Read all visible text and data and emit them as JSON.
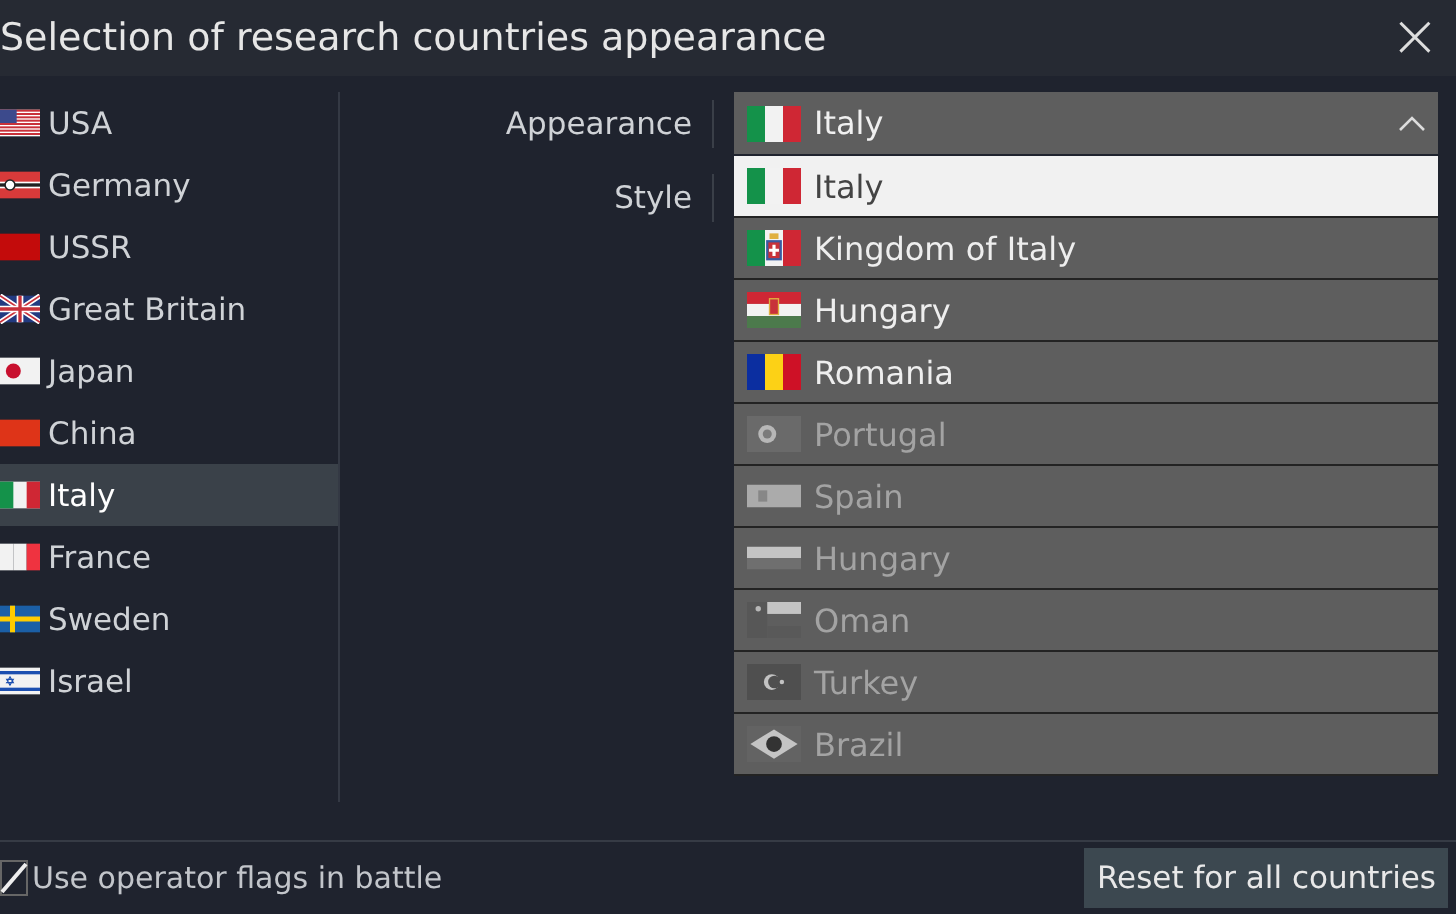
{
  "window": {
    "title": "Selection of research countries appearance",
    "close": "×"
  },
  "countries": [
    {
      "name": "USA",
      "kind": "usa",
      "selected": false
    },
    {
      "name": "Germany",
      "kind": "germany",
      "selected": false
    },
    {
      "name": "USSR",
      "kind": "ussr",
      "selected": false
    },
    {
      "name": "Great Britain",
      "kind": "britain",
      "selected": false
    },
    {
      "name": "Japan",
      "kind": "japan",
      "selected": false
    },
    {
      "name": "China",
      "kind": "china",
      "selected": false
    },
    {
      "name": "Italy",
      "kind": "italy",
      "selected": true
    },
    {
      "name": "France",
      "kind": "france",
      "selected": false
    },
    {
      "name": "Sweden",
      "kind": "sweden",
      "selected": false
    },
    {
      "name": "Israel",
      "kind": "israel",
      "selected": false
    }
  ],
  "appearance": {
    "label": "Appearance",
    "value": "Italy",
    "kind": "italy",
    "expanded": true
  },
  "style": {
    "label": "Style"
  },
  "options": [
    {
      "name": "Italy",
      "kind": "italy",
      "selected": true,
      "disabled": false
    },
    {
      "name": "Kingdom of Italy",
      "kind": "kingdom_italy",
      "selected": false,
      "disabled": false
    },
    {
      "name": "Hungary",
      "kind": "hungary_royal",
      "selected": false,
      "disabled": false
    },
    {
      "name": "Romania",
      "kind": "romania",
      "selected": false,
      "disabled": false
    },
    {
      "name": "Portugal",
      "kind": "portugal",
      "selected": false,
      "disabled": true
    },
    {
      "name": "Spain",
      "kind": "spain",
      "selected": false,
      "disabled": true
    },
    {
      "name": "Hungary",
      "kind": "hungary",
      "selected": false,
      "disabled": true
    },
    {
      "name": "Oman",
      "kind": "oman",
      "selected": false,
      "disabled": true
    },
    {
      "name": "Turkey",
      "kind": "turkey",
      "selected": false,
      "disabled": true
    },
    {
      "name": "Brazil",
      "kind": "brazil",
      "selected": false,
      "disabled": true
    }
  ],
  "operator_flags": {
    "label": "Use operator flags in battle",
    "checked": true
  },
  "reset_button": "Reset for all countries"
}
